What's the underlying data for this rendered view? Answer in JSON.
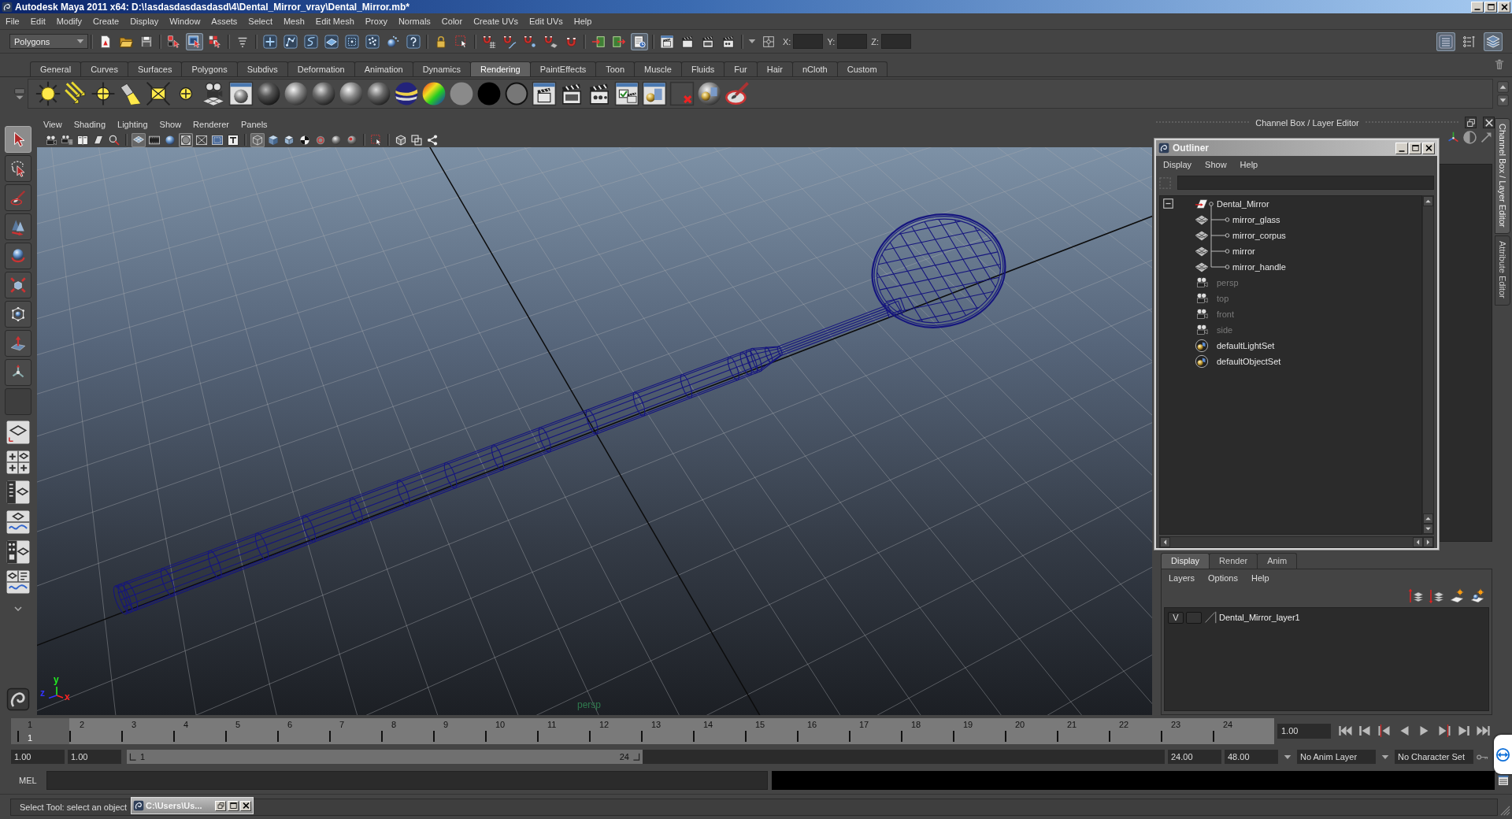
{
  "window": {
    "title": "Autodesk Maya 2011 x64: D:\\!asdasdasdasdasd\\4\\Dental_Mirror_vray\\Dental_Mirror.mb*"
  },
  "menu_bar": [
    "File",
    "Edit",
    "Modify",
    "Create",
    "Display",
    "Window",
    "Assets",
    "Select",
    "Mesh",
    "Edit Mesh",
    "Proxy",
    "Normals",
    "Color",
    "Create UVs",
    "Edit UVs",
    "Help"
  ],
  "status_line": {
    "menu_set": "Polygons",
    "groups": [
      [
        {
          "kind": "newfile",
          "on": false
        },
        {
          "kind": "open",
          "on": false
        },
        {
          "kind": "save",
          "on": false
        }
      ],
      [
        {
          "kind": "hierarchy",
          "on": false
        },
        {
          "kind": "objects",
          "on": true
        },
        {
          "kind": "components",
          "on": false
        }
      ],
      [
        {
          "kind": "filter",
          "on": false
        }
      ],
      [
        {
          "kind": "plus",
          "on": false
        },
        {
          "kind": "graph",
          "on": false
        },
        {
          "kind": "curve",
          "on": false
        },
        {
          "kind": "plane",
          "on": false
        },
        {
          "kind": "frame",
          "on": false
        },
        {
          "kind": "dots",
          "on": false
        },
        {
          "kind": "splash",
          "on": false
        },
        {
          "kind": "question",
          "on": false
        }
      ],
      [
        {
          "kind": "lock",
          "on": false
        },
        {
          "kind": "selbox",
          "on": false
        }
      ],
      [
        {
          "kind": "magnetgrid",
          "on": false
        },
        {
          "kind": "magnetcurve",
          "on": false
        },
        {
          "kind": "magnetpoint",
          "on": false
        },
        {
          "kind": "magnetplane",
          "on": false
        },
        {
          "kind": "magnet",
          "on": false
        }
      ],
      [
        {
          "kind": "input",
          "on": false
        },
        {
          "kind": "output",
          "on": false
        },
        {
          "kind": "history",
          "on": true
        }
      ],
      [
        {
          "kind": "renderwin",
          "on": false
        },
        {
          "kind": "render",
          "on": false
        },
        {
          "kind": "ipr",
          "on": false
        },
        {
          "kind": "rsettings",
          "on": false
        }
      ]
    ],
    "coordinates": [
      {
        "label": "X:"
      },
      {
        "label": "Y:"
      },
      {
        "label": "Z:"
      }
    ],
    "panels": [
      {
        "kind": "channels",
        "on": true
      },
      {
        "kind": "toolsettings",
        "on": false
      },
      {
        "kind": "layers",
        "on": true
      }
    ]
  },
  "shelf": {
    "tabs": [
      {
        "label": "General",
        "selected": false
      },
      {
        "label": "Curves",
        "selected": false
      },
      {
        "label": "Surfaces",
        "selected": false
      },
      {
        "label": "Polygons",
        "selected": false
      },
      {
        "label": "Subdivs",
        "selected": false
      },
      {
        "label": "Deformation",
        "selected": false
      },
      {
        "label": "Animation",
        "selected": false
      },
      {
        "label": "Dynamics",
        "selected": false
      },
      {
        "label": "Rendering",
        "selected": true
      },
      {
        "label": "PaintEffects",
        "selected": false
      },
      {
        "label": "Toon",
        "selected": false
      },
      {
        "label": "Muscle",
        "selected": false
      },
      {
        "label": "Fluids",
        "selected": false
      },
      {
        "label": "Fur",
        "selected": false
      },
      {
        "label": "Hair",
        "selected": false
      },
      {
        "label": "nCloth",
        "selected": false
      },
      {
        "label": "Custom",
        "selected": false
      }
    ]
  },
  "toolbox": {
    "tools": [
      {
        "kind": "select",
        "selected": true
      },
      {
        "kind": "lasso",
        "selected": false
      },
      {
        "kind": "paint",
        "selected": false
      },
      {
        "kind": "cones",
        "selected": false
      },
      {
        "kind": "rotate",
        "selected": false
      },
      {
        "kind": "scale",
        "selected": false
      },
      {
        "kind": "manip",
        "selected": false
      },
      {
        "kind": "softmod",
        "selected": false
      },
      {
        "kind": "tripod",
        "selected": false
      }
    ]
  },
  "viewport": {
    "menus": [
      "View",
      "Shading",
      "Lighting",
      "Show",
      "Renderer",
      "Panels"
    ],
    "toolbar": [
      [
        {
          "kind": "cam",
          "on": false
        },
        {
          "kind": "camattr",
          "on": false
        },
        {
          "kind": "bookmark",
          "on": false
        },
        {
          "kind": "imgplane",
          "on": false
        },
        {
          "kind": "pan",
          "on": false
        }
      ],
      [
        {
          "kind": "gridp",
          "on": true
        },
        {
          "kind": "film",
          "on": false
        },
        {
          "kind": "ball",
          "on": false
        },
        {
          "kind": "gate",
          "on": true
        },
        {
          "kind": "xbox",
          "on": false
        },
        {
          "kind": "safe",
          "on": false
        },
        {
          "kind": "textT",
          "on": false
        }
      ],
      [
        {
          "kind": "wirecube",
          "on": true
        },
        {
          "kind": "solidcube",
          "on": false
        },
        {
          "kind": "shadedcube",
          "on": false
        },
        {
          "kind": "checker",
          "on": false
        },
        {
          "kind": "lightring",
          "on": false
        },
        {
          "kind": "greyball",
          "on": false
        },
        {
          "kind": "redball",
          "on": false
        }
      ],
      [
        {
          "kind": "selcursor",
          "on": false
        }
      ],
      [
        {
          "kind": "cubeout",
          "on": false
        },
        {
          "kind": "overlap",
          "on": false
        },
        {
          "kind": "nodes",
          "on": false
        }
      ]
    ],
    "camera_label": "persp",
    "axis_labels": [
      {
        "kind": "y",
        "label": "y"
      },
      {
        "kind": "z",
        "label": "z"
      },
      {
        "kind": "x",
        "label": "x"
      }
    ]
  },
  "channel_box": {
    "title": "Channel Box / Layer Editor"
  },
  "outliner": {
    "title": "Outliner",
    "menus": [
      "Display",
      "Show",
      "Help"
    ],
    "items": [
      {
        "name": "Dental_Mirror",
        "kind": "group",
        "hidden": false,
        "expanded": true,
        "children": [
          {
            "name": "mirror_glass",
            "kind": "mesh",
            "hidden": false
          },
          {
            "name": "mirror_corpus",
            "kind": "mesh",
            "hidden": false
          },
          {
            "name": "mirror",
            "kind": "mesh",
            "hidden": false
          },
          {
            "name": "mirror_handle",
            "kind": "mesh",
            "hidden": false
          }
        ]
      },
      {
        "name": "persp",
        "kind": "camera",
        "hidden": true
      },
      {
        "name": "top",
        "kind": "camera",
        "hidden": true
      },
      {
        "name": "front",
        "kind": "camera",
        "hidden": true
      },
      {
        "name": "side",
        "kind": "camera",
        "hidden": true
      },
      {
        "name": "defaultLightSet",
        "kind": "set",
        "hidden": false
      },
      {
        "name": "defaultObjectSet",
        "kind": "set",
        "hidden": false
      }
    ]
  },
  "layer_editor": {
    "tabs": [
      {
        "label": "Display",
        "selected": true
      },
      {
        "label": "Render",
        "selected": false
      },
      {
        "label": "Anim",
        "selected": false
      }
    ],
    "menus": [
      "Layers",
      "Options",
      "Help"
    ],
    "layers": [
      {
        "visibility": "V",
        "name": "Dental_Mirror_layer1"
      }
    ]
  },
  "side_tabs": [
    {
      "label": "Channel Box / Layer Editor",
      "selected": true
    },
    {
      "label": "Attribute Editor",
      "selected": false
    }
  ],
  "time_slider": {
    "ticks": [
      {
        "label": "1",
        "selected": true
      },
      {
        "label": "2",
        "selected": false
      },
      {
        "label": "3",
        "selected": false
      },
      {
        "label": "4",
        "selected": false
      },
      {
        "label": "5",
        "selected": false
      },
      {
        "label": "6",
        "selected": false
      },
      {
        "label": "7",
        "selected": false
      },
      {
        "label": "8",
        "selected": false
      },
      {
        "label": "9",
        "selected": false
      },
      {
        "label": "10",
        "selected": false
      },
      {
        "label": "11",
        "selected": false
      },
      {
        "label": "12",
        "selected": false
      },
      {
        "label": "13",
        "selected": false
      },
      {
        "label": "14",
        "selected": false
      },
      {
        "label": "15",
        "selected": false
      },
      {
        "label": "16",
        "selected": false
      },
      {
        "label": "17",
        "selected": false
      },
      {
        "label": "18",
        "selected": false
      },
      {
        "label": "19",
        "selected": false
      },
      {
        "label": "20",
        "selected": false
      },
      {
        "label": "21",
        "selected": false
      },
      {
        "label": "22",
        "selected": false
      },
      {
        "label": "23",
        "selected": false
      },
      {
        "label": "24",
        "selected": false
      }
    ],
    "current_frame": "1",
    "current_time": "1.00"
  },
  "range_slider": {
    "start_time": "1.00",
    "playback_start": "1.00",
    "range_start": "1",
    "range_end": "24",
    "playback_end": "24.00",
    "end_time": "48.00",
    "anim_layer": "No Anim Layer",
    "character_set": "No Character Set"
  },
  "command_line": {
    "language": "MEL"
  },
  "help_line": {
    "text": "Select Tool: select an object",
    "minimized_window": "C:\\Users\\Us..."
  }
}
